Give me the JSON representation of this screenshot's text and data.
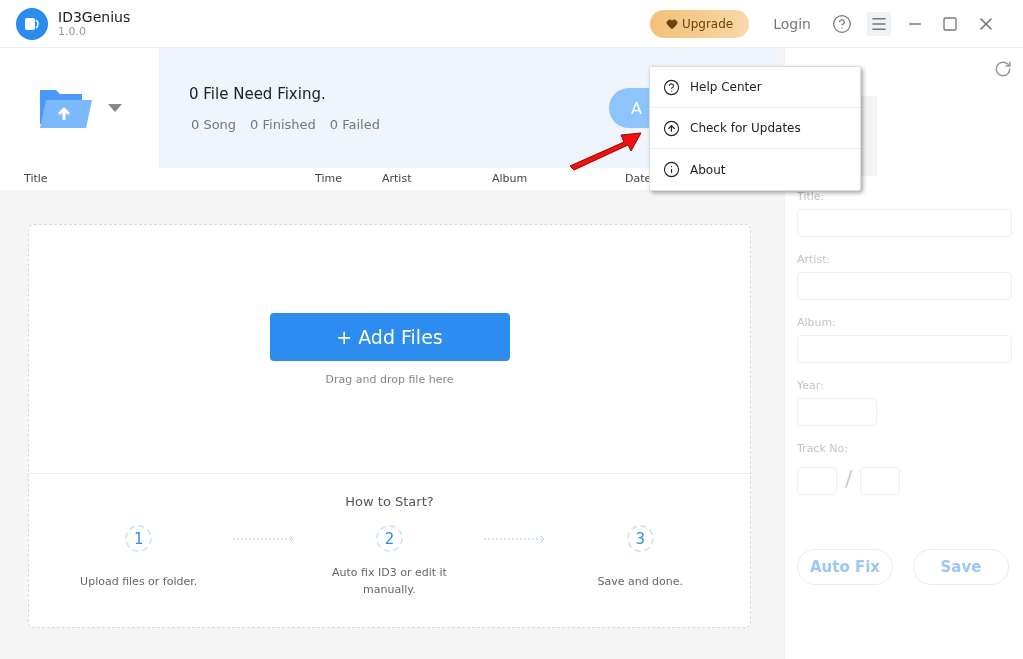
{
  "app": {
    "name": "ID3Genius",
    "version": "1.0.0"
  },
  "titlebar": {
    "upgrade": "Upgrade",
    "login": "Login"
  },
  "summary": {
    "headline": "0 File Need Fixing.",
    "stats": [
      "0 Song",
      "0 Finished",
      "0 Failed"
    ],
    "fix_button": "A"
  },
  "table": {
    "columns": [
      "Title",
      "Time",
      "Artist",
      "Album",
      "Date"
    ]
  },
  "dropzone": {
    "add_button": "+ Add Files",
    "hint": "Drag and drop file here"
  },
  "how_to": {
    "title": "How to Start?",
    "steps": [
      {
        "number": "1",
        "text": "Upload files or folder."
      },
      {
        "number": "2",
        "text": "Auto fix ID3 or edit it manually."
      },
      {
        "number": "3",
        "text": "Save and done."
      }
    ]
  },
  "editor": {
    "fields": [
      {
        "label": "Title:",
        "kind": "wide"
      },
      {
        "label": "Artist:",
        "kind": "wide"
      },
      {
        "label": "Album:",
        "kind": "wide"
      },
      {
        "label": "Year:",
        "kind": "short"
      },
      {
        "label": "Track No:",
        "kind": "track",
        "separator": "/"
      }
    ],
    "buttons": [
      "Auto Fix",
      "Save"
    ]
  },
  "menu": {
    "items": [
      {
        "label": "Help Center",
        "kind": "help"
      },
      {
        "label": "Check for Updates",
        "kind": "update"
      },
      {
        "label": "About",
        "kind": "about"
      }
    ]
  }
}
